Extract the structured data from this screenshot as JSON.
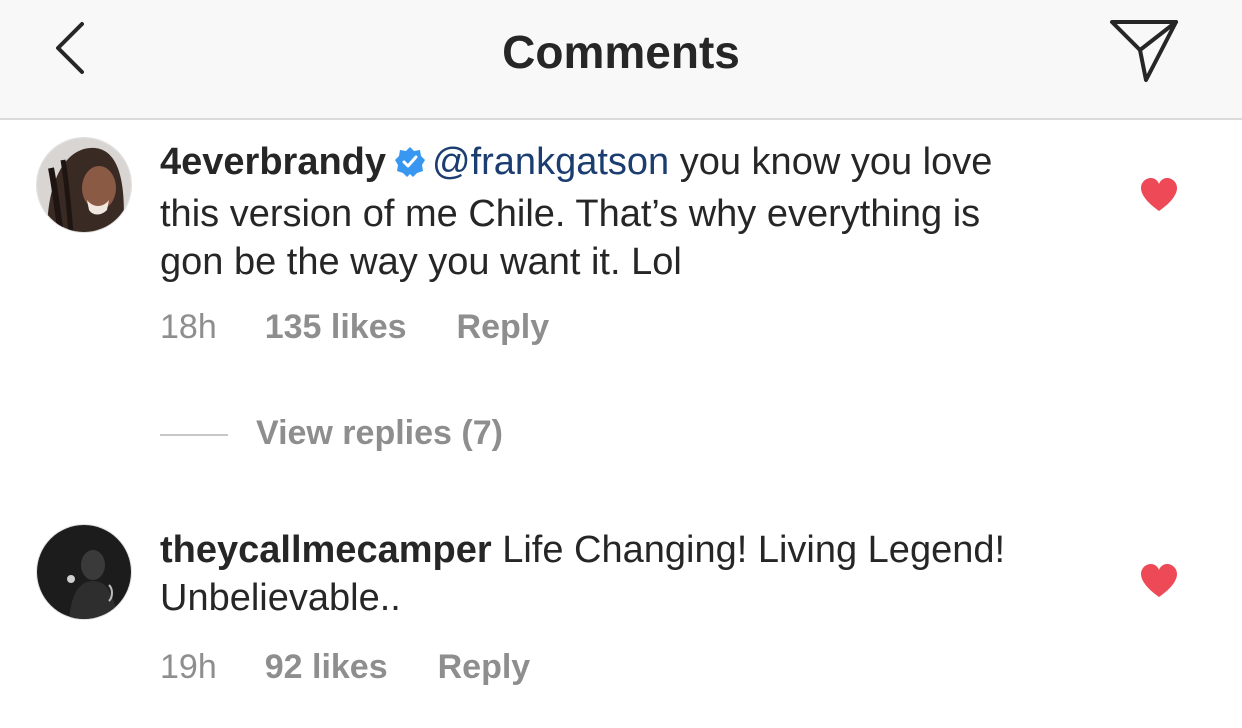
{
  "header": {
    "title": "Comments",
    "back_icon": "chevron-left-icon",
    "share_icon": "paper-plane-icon"
  },
  "comments": [
    {
      "username": "4everbrandy",
      "verified": true,
      "mention": "@frankgatson",
      "text": "you know you love this version of me Chile. That’s why everything is gon be the way you want it. Lol",
      "time": "18h",
      "likes": "135 likes",
      "reply_label": "Reply",
      "liked": true
    },
    {
      "username": "theycallmecamper",
      "verified": false,
      "text": "Life Changing! Living Legend! Unbelievable..",
      "time": "19h",
      "likes": "92 likes",
      "reply_label": "Reply",
      "liked": true
    }
  ],
  "view_replies": "View replies (7)",
  "colors": {
    "heart": "#ed4956",
    "verified": "#3897f0",
    "mention": "#1c3d70",
    "meta": "#8e8e8e",
    "header_bg": "#f8f8f8"
  }
}
